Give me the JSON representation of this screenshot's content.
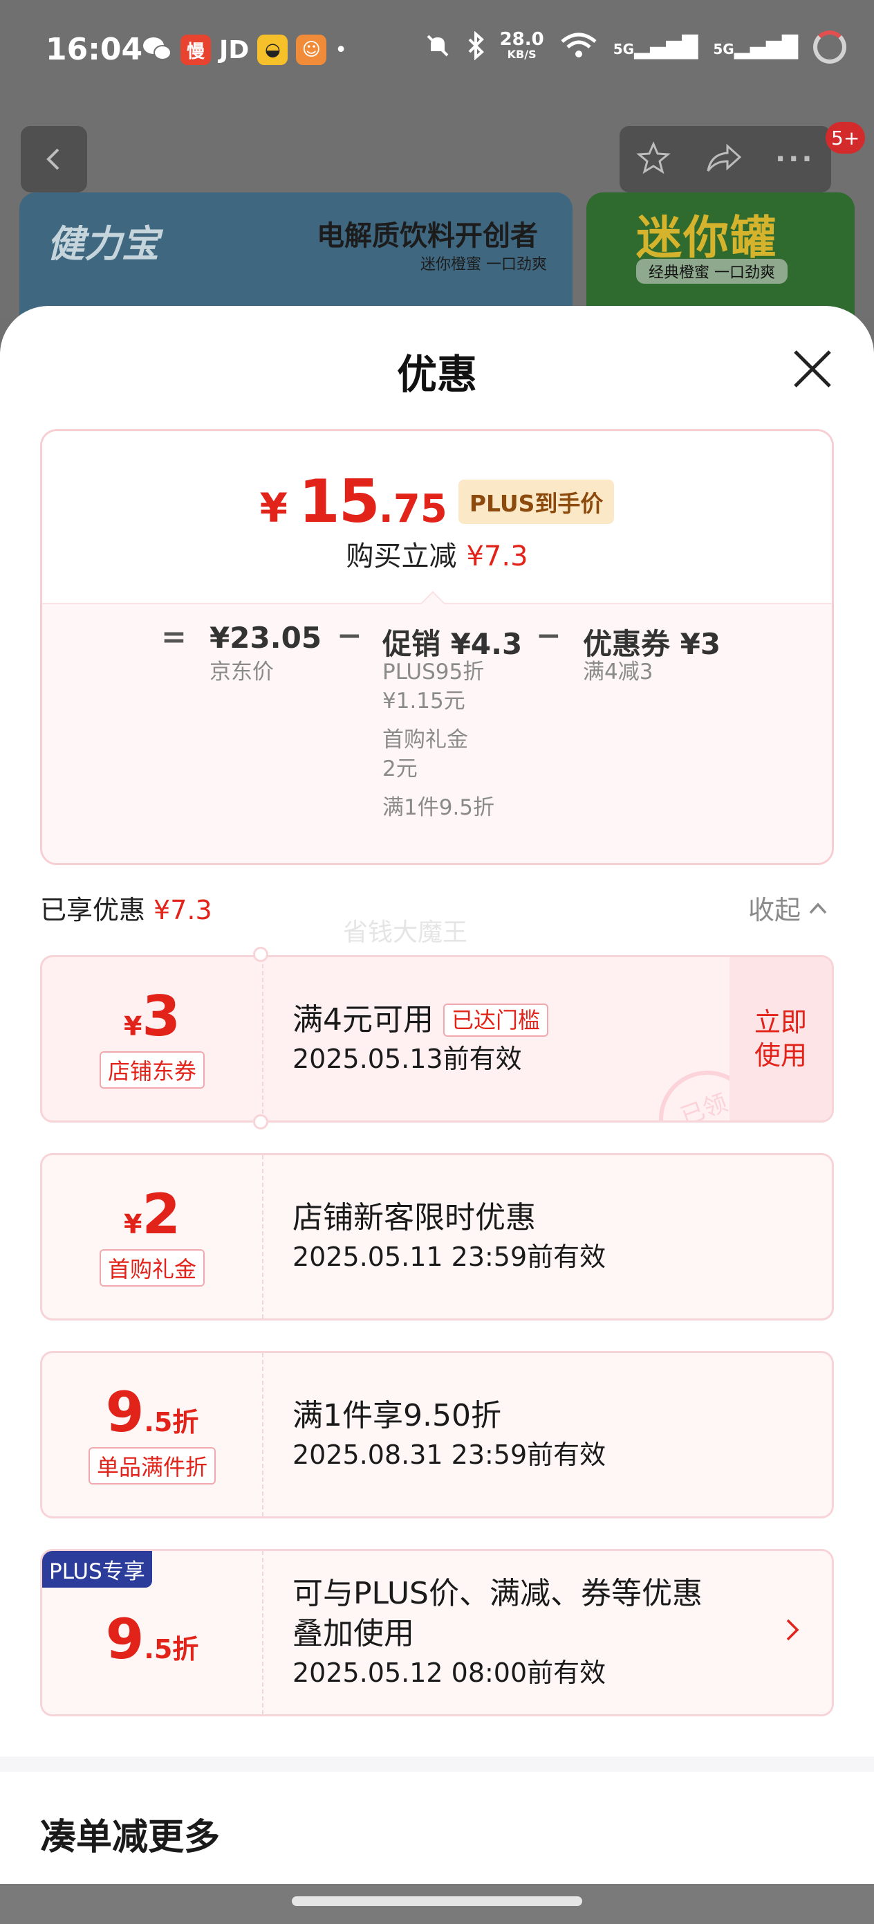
{
  "status_bar": {
    "time": "16:04",
    "app_icons": [
      "wechat-icon",
      "app-badge-icon",
      "jd-icon",
      "app-badge-icon",
      "app-badge-icon"
    ],
    "jd_label": "JD",
    "net_speed": "28.0",
    "net_unit": "KB/S",
    "sig1": "5G",
    "sig2": "5G"
  },
  "nav": {
    "badge": "5+"
  },
  "banner": {
    "logo": "健力宝",
    "title": "电解质饮料开创者",
    "subtitle": "迷你橙蜜 一口劲爽",
    "side_title": "迷你罐",
    "side_subtitle": "经典橙蜜 一口劲爽"
  },
  "sheet": {
    "title": "优惠",
    "price": {
      "yen": "¥",
      "integer": "15",
      "decimal": ".75",
      "tag": "PLUS到手价",
      "reduce_label": "购买立减",
      "reduce_value": "¥7.3"
    },
    "breakdown": {
      "eq": "=",
      "minus1": "−",
      "minus2": "−",
      "jd_price": "¥23.05",
      "jd_price_label": "京东价",
      "promo": "促销 ¥4.3",
      "promo_lines": [
        "PLUS95折",
        "¥1.15元",
        "首购礼金",
        "2元",
        "满1件9.5折"
      ],
      "coupon": "优惠券 ¥3",
      "coupon_line": "满4减3"
    },
    "enjoyed": {
      "label": "已享优惠",
      "value": "¥7.3"
    },
    "collapse_label": "收起",
    "watermark": "省钱大魔王",
    "coupons": [
      {
        "yen": "¥",
        "amount": "3",
        "suffix": "",
        "tag": "店铺东券",
        "title": "满4元可用",
        "title_tag": "已达门槛",
        "date": "2025.05.13前有效",
        "action": "立即\n使用",
        "stamp": "已领"
      },
      {
        "yen": "¥",
        "amount": "2",
        "suffix": "",
        "tag": "首购礼金",
        "title": "店铺新客限时优惠",
        "date": "2025.05.11 23:59前有效"
      },
      {
        "amount": "9",
        "suffix": ".5折",
        "tag": "单品满件折",
        "title": "满1件享9.50折",
        "date": "2025.08.31 23:59前有效"
      },
      {
        "flag": "PLUS专享",
        "amount": "9",
        "suffix": ".5折",
        "title_line1": "可与PLUS价、满减、券等优惠",
        "title_line2": "叠加使用",
        "date": "2025.05.12 08:00前有效"
      }
    ],
    "more_title": "凑单减更多"
  },
  "colors": {
    "accent_red": "#e2231a",
    "plus_blue": "#2b3c9a",
    "plus_gold_bg": "#fbe8c6"
  }
}
